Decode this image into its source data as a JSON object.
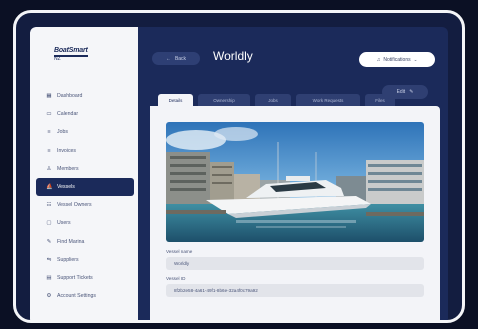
{
  "logo": {
    "main": "BoatSmart",
    "sub": "NZ"
  },
  "sidebar": {
    "items": [
      {
        "label": "Dashboard",
        "icon": "grid-icon",
        "active": false
      },
      {
        "label": "Calendar",
        "icon": "calendar-icon",
        "active": false
      },
      {
        "label": "Jobs",
        "icon": "list-icon",
        "active": false
      },
      {
        "label": "Invoices",
        "icon": "list-icon",
        "active": false
      },
      {
        "label": "Members",
        "icon": "person-icon",
        "active": false
      },
      {
        "label": "Vessels",
        "icon": "boat-icon",
        "active": true
      },
      {
        "label": "Vessel Owners",
        "icon": "people-icon",
        "active": false
      },
      {
        "label": "Users",
        "icon": "user-icon",
        "active": false
      },
      {
        "label": "Find Marina",
        "icon": "pin-icon",
        "active": false
      },
      {
        "label": "Suppliers",
        "icon": "truck-icon",
        "active": false
      },
      {
        "label": "Support Tickets",
        "icon": "ticket-icon",
        "active": false
      },
      {
        "label": "Account Settings",
        "icon": "gear-icon",
        "active": false
      }
    ]
  },
  "header": {
    "back_label": "Back",
    "title": "Worldly",
    "notifications_label": "Notifications"
  },
  "tabs": [
    {
      "label": "Details",
      "active": true
    },
    {
      "label": "Ownership",
      "active": false
    },
    {
      "label": "Jobs",
      "active": false
    },
    {
      "label": "Work Requests",
      "active": false
    },
    {
      "label": "Files",
      "active": false
    }
  ],
  "edit_label": "Edit",
  "form": {
    "vessel_name_label": "Vessel name",
    "vessel_name_value": "Worldly",
    "vessel_id_label": "Vessel ID",
    "vessel_id_value": "8f2b2e58-4a61-49f1-8b6e-32a4f0c79a92"
  },
  "colors": {
    "navy": "#1b2a5a",
    "background": "#0b1024",
    "sidebar": "#f5f6f9",
    "panel": "#f3f4f8"
  }
}
